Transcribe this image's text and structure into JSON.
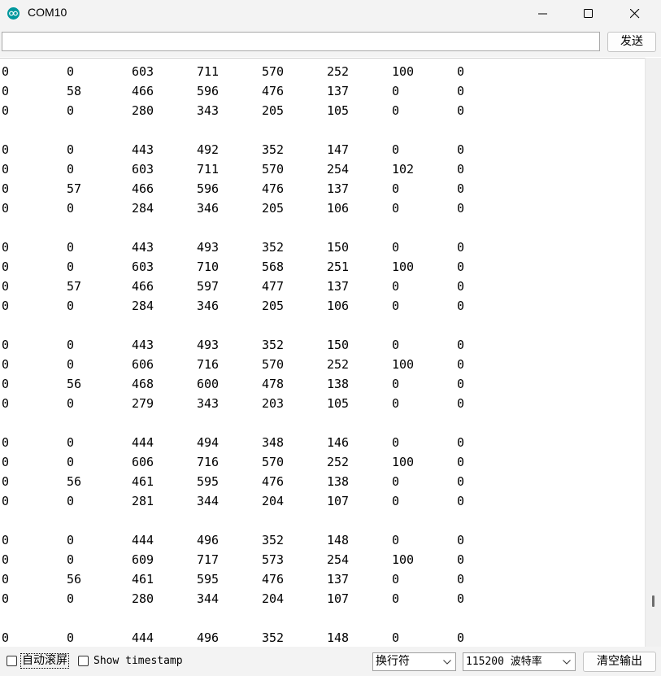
{
  "window": {
    "title": "COM10",
    "icon": "arduino-icon",
    "controls": {
      "minimize": "minimize-icon",
      "maximize": "maximize-icon",
      "close": "close-icon"
    }
  },
  "send": {
    "value": "",
    "button_label": "发送"
  },
  "output": {
    "lines": [
      [
        "0",
        "0",
        "603",
        "711",
        "570",
        "252",
        "100",
        "0"
      ],
      [
        "0",
        "58",
        "466",
        "596",
        "476",
        "137",
        "0",
        "0"
      ],
      [
        "0",
        "0",
        "280",
        "343",
        "205",
        "105",
        "0",
        "0"
      ],
      [],
      [
        "0",
        "0",
        "443",
        "492",
        "352",
        "147",
        "0",
        "0"
      ],
      [
        "0",
        "0",
        "603",
        "711",
        "570",
        "254",
        "102",
        "0"
      ],
      [
        "0",
        "57",
        "466",
        "596",
        "476",
        "137",
        "0",
        "0"
      ],
      [
        "0",
        "0",
        "284",
        "346",
        "205",
        "106",
        "0",
        "0"
      ],
      [],
      [
        "0",
        "0",
        "443",
        "493",
        "352",
        "150",
        "0",
        "0"
      ],
      [
        "0",
        "0",
        "603",
        "710",
        "568",
        "251",
        "100",
        "0"
      ],
      [
        "0",
        "57",
        "466",
        "597",
        "477",
        "137",
        "0",
        "0"
      ],
      [
        "0",
        "0",
        "284",
        "346",
        "205",
        "106",
        "0",
        "0"
      ],
      [],
      [
        "0",
        "0",
        "443",
        "493",
        "352",
        "150",
        "0",
        "0"
      ],
      [
        "0",
        "0",
        "606",
        "716",
        "570",
        "252",
        "100",
        "0"
      ],
      [
        "0",
        "56",
        "468",
        "600",
        "478",
        "138",
        "0",
        "0"
      ],
      [
        "0",
        "0",
        "279",
        "343",
        "203",
        "105",
        "0",
        "0"
      ],
      [],
      [
        "0",
        "0",
        "444",
        "494",
        "348",
        "146",
        "0",
        "0"
      ],
      [
        "0",
        "0",
        "606",
        "716",
        "570",
        "252",
        "100",
        "0"
      ],
      [
        "0",
        "56",
        "461",
        "595",
        "476",
        "138",
        "0",
        "0"
      ],
      [
        "0",
        "0",
        "281",
        "344",
        "204",
        "107",
        "0",
        "0"
      ],
      [],
      [
        "0",
        "0",
        "444",
        "496",
        "352",
        "148",
        "0",
        "0"
      ],
      [
        "0",
        "0",
        "609",
        "717",
        "573",
        "254",
        "100",
        "0"
      ],
      [
        "0",
        "56",
        "461",
        "595",
        "476",
        "137",
        "0",
        "0"
      ],
      [
        "0",
        "0",
        "280",
        "344",
        "204",
        "107",
        "0",
        "0"
      ],
      [],
      [
        "0",
        "0",
        "444",
        "496",
        "352",
        "148",
        "0",
        "0"
      ]
    ]
  },
  "bottom": {
    "autoscroll_label": "自动滚屏",
    "autoscroll_checked": false,
    "timestamp_label": "Show timestamp",
    "timestamp_checked": false,
    "line_ending": "换行符",
    "baud_rate": "115200 波特率",
    "clear_button": "清空输出"
  },
  "colors": {
    "accent": "#00979d",
    "chrome": "#f3f3f3"
  }
}
